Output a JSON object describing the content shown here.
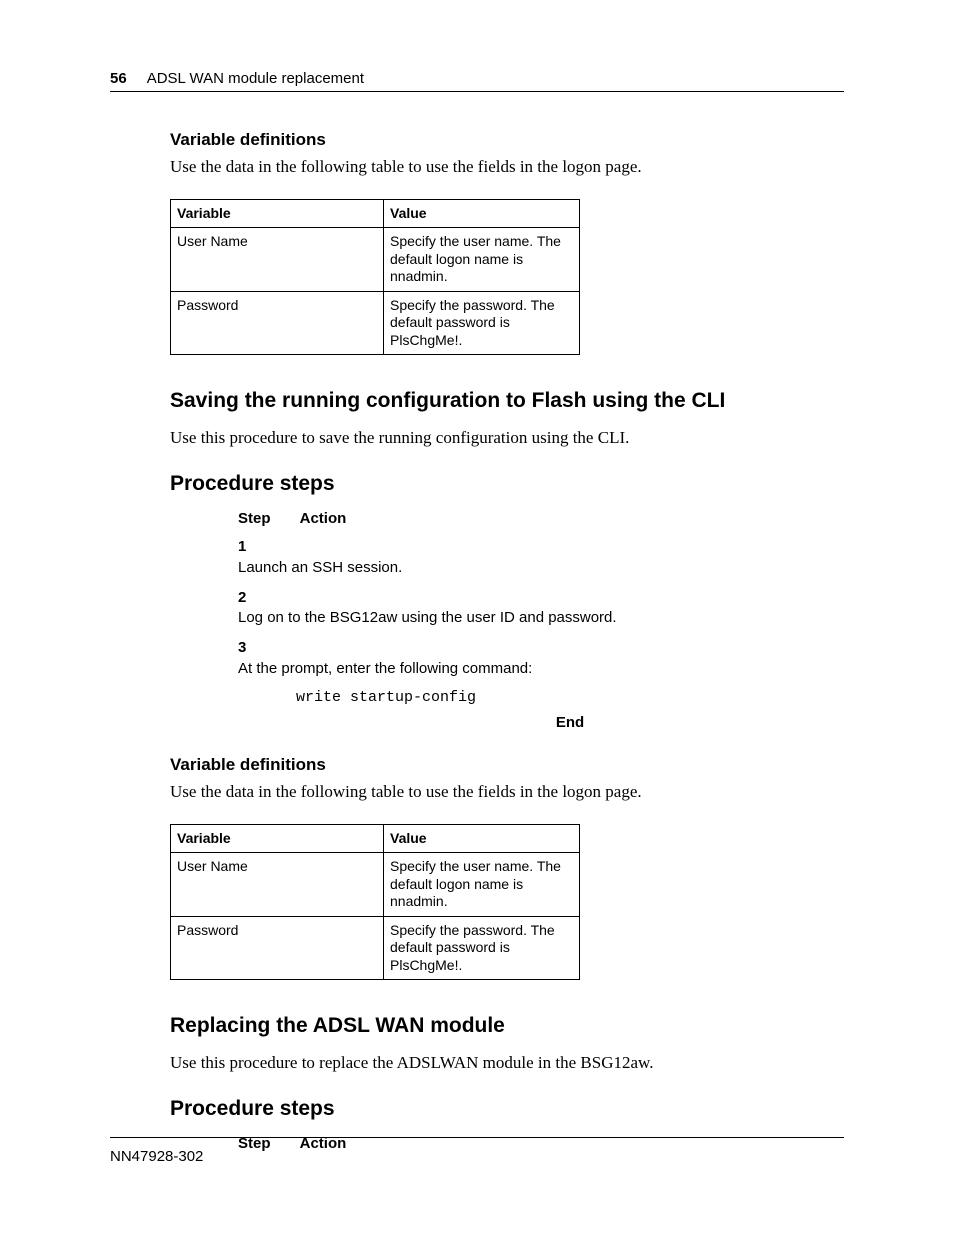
{
  "header": {
    "page_number": "56",
    "title": "ADSL WAN module replacement"
  },
  "sec1": {
    "heading": "Variable definitions",
    "intro": "Use the data in the following table to use the fields in the logon page.",
    "table": {
      "h1": "Variable",
      "h2": "Value",
      "rows": [
        {
          "v": "User Name",
          "d": "Specify the user name. The default logon name is nnadmin."
        },
        {
          "v": "Password",
          "d": "Specify the password. The default password is PlsChgMe!."
        }
      ]
    }
  },
  "sec2": {
    "heading": "Saving the running configuration to Flash using the CLI",
    "intro": "Use this procedure to save the running configuration using the CLI."
  },
  "steps1": {
    "heading": "Procedure steps",
    "col_step": "Step",
    "col_action": "Action",
    "rows": [
      {
        "n": "1",
        "a": "Launch an SSH session."
      },
      {
        "n": "2",
        "a": "Log on to the BSG12aw using the user ID and password."
      },
      {
        "n": "3",
        "a": "At the prompt, enter the following command:"
      }
    ],
    "command": "write startup-config",
    "end": "End"
  },
  "sec3": {
    "heading": "Variable definitions",
    "intro": "Use the data in the following table to use the fields in the logon page.",
    "table": {
      "h1": "Variable",
      "h2": "Value",
      "rows": [
        {
          "v": "User Name",
          "d": "Specify the user name. The default logon name is nnadmin."
        },
        {
          "v": "Password",
          "d": "Specify the password. The default password is PlsChgMe!."
        }
      ]
    }
  },
  "sec4": {
    "heading": "Replacing the ADSL WAN module",
    "intro": "Use this procedure to replace the ADSLWAN module in the BSG12aw."
  },
  "steps2": {
    "heading": "Procedure steps",
    "col_step": "Step",
    "col_action": "Action"
  },
  "footer": {
    "doc_id": "NN47928-302"
  }
}
